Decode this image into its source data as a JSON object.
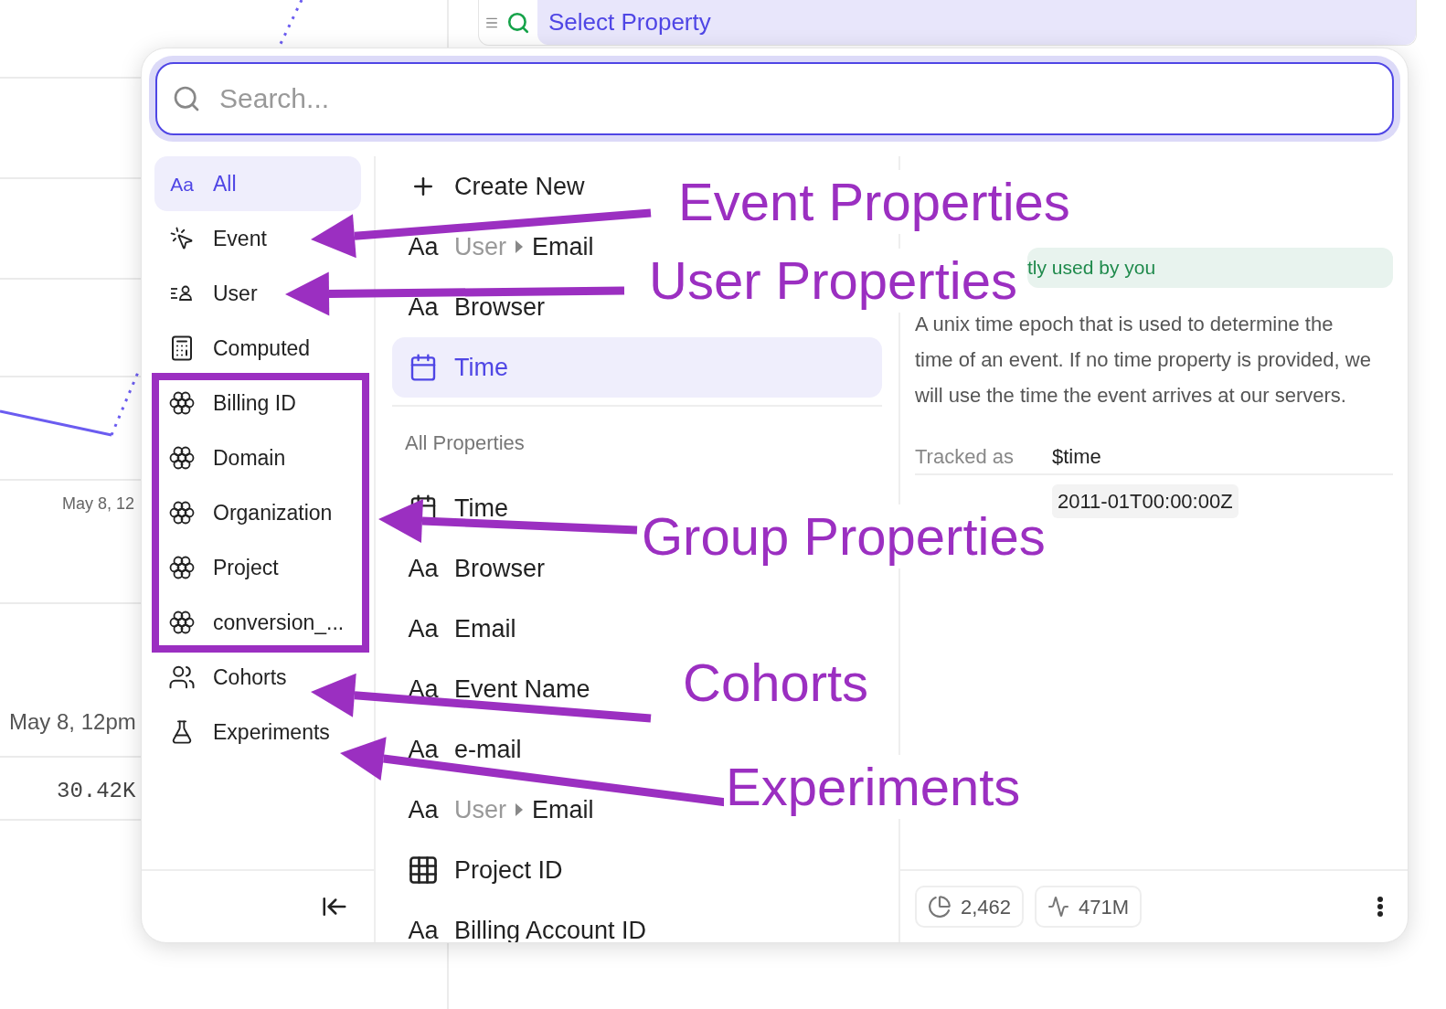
{
  "background": {
    "query_bar": {
      "label": "Select Property"
    },
    "axis_labels": [
      "May 8, 12",
      "May 8, 12pm"
    ],
    "value_label": "30.42K"
  },
  "popup": {
    "search": {
      "placeholder": "Search..."
    },
    "sidebar": {
      "items": [
        {
          "kind": "text",
          "glyph": "Aa",
          "label": "All",
          "selected": true
        },
        {
          "kind": "event",
          "label": "Event",
          "selected": false
        },
        {
          "kind": "user",
          "label": "User",
          "selected": false
        },
        {
          "kind": "computed",
          "label": "Computed",
          "selected": false
        },
        {
          "kind": "group",
          "label": "Billing ID",
          "selected": false
        },
        {
          "kind": "group",
          "label": "Domain",
          "selected": false
        },
        {
          "kind": "group",
          "label": "Organization",
          "selected": false
        },
        {
          "kind": "group",
          "label": "Project",
          "selected": false
        },
        {
          "kind": "group",
          "label": "conversion_...",
          "selected": false
        },
        {
          "kind": "cohort",
          "label": "Cohorts",
          "selected": false
        },
        {
          "kind": "experiment",
          "label": "Experiments",
          "selected": false
        }
      ]
    },
    "recent": [
      {
        "kind": "create",
        "label": "Create New",
        "selected": false
      },
      {
        "kind": "text",
        "glyph": "Aa",
        "parent": "User",
        "label": "Email",
        "selected": false
      },
      {
        "kind": "text",
        "glyph": "Aa",
        "label": "Browser",
        "selected": false
      },
      {
        "kind": "date",
        "label": "Time",
        "selected": true
      }
    ],
    "all_header": "All Properties",
    "all": [
      {
        "kind": "date",
        "label": "Time"
      },
      {
        "kind": "text",
        "glyph": "Aa",
        "label": "Browser"
      },
      {
        "kind": "text",
        "glyph": "Aa",
        "label": "Email"
      },
      {
        "kind": "text",
        "glyph": "Aa",
        "label": "Event Name"
      },
      {
        "kind": "text",
        "glyph": "Aa",
        "label": "e-mail"
      },
      {
        "kind": "text",
        "glyph": "Aa",
        "parent": "User",
        "label": "Email"
      },
      {
        "kind": "table",
        "label": "Project ID"
      },
      {
        "kind": "text",
        "glyph": "Aa",
        "label": "Billing Account ID"
      }
    ],
    "details": {
      "usage_note": "tly used by you",
      "description": "A unix time epoch that is used to determine the time of an event. If no time property is provided, we will use the time the event arrives at our servers.",
      "tracked_label": "Tracked as",
      "tracked_value": "$time",
      "example": "2011-01T00:00:00Z",
      "stats": [
        {
          "kind": "pie",
          "value": "2,462"
        },
        {
          "kind": "pulse",
          "value": "471M"
        }
      ]
    }
  },
  "annotations": [
    "Event Properties",
    "User Properties",
    "Group Properties",
    "Cohorts",
    "Experiments"
  ]
}
